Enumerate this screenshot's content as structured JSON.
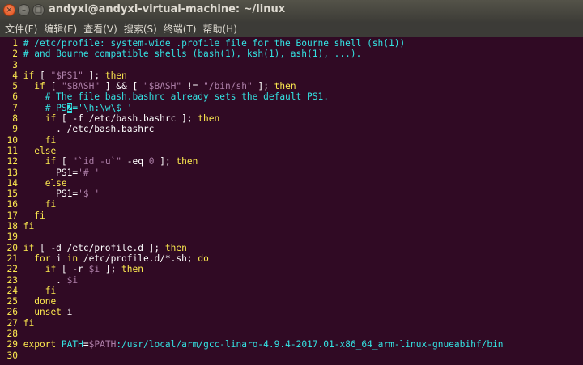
{
  "window": {
    "title": "andyxi@andyxi-virtual-machine: ~/linux",
    "close_glyph": "×",
    "min_glyph": "–",
    "max_glyph": "□"
  },
  "menu": [
    "文件(F)",
    "编辑(E)",
    "查看(V)",
    "搜索(S)",
    "终端(T)",
    "帮助(H)"
  ],
  "colors": {
    "background": "#300a24",
    "line_number": "#fce94f",
    "comment": "#34e2e2",
    "keyword": "#fce94f",
    "string": "#ad7fa8",
    "text": "#ffffff"
  },
  "lines": [
    {
      "n": "1",
      "segs": [
        [
          "c",
          "# /etc/profile: system-wide .profile file for the Bourne shell (sh(1))"
        ]
      ]
    },
    {
      "n": "2",
      "segs": [
        [
          "c",
          "# and Bourne compatible shells (bash(1), ksh(1), ash(1), ...)."
        ]
      ]
    },
    {
      "n": "3",
      "segs": []
    },
    {
      "n": "4",
      "segs": [
        [
          "k",
          "if"
        ],
        [
          "w",
          " [ "
        ],
        [
          "s",
          "\"$PS1\""
        ],
        [
          "w",
          " ]; "
        ],
        [
          "k",
          "then"
        ]
      ]
    },
    {
      "n": "5",
      "segs": [
        [
          "w",
          "  "
        ],
        [
          "k",
          "if"
        ],
        [
          "w",
          " [ "
        ],
        [
          "s",
          "\"$BASH\""
        ],
        [
          "w",
          " ] && [ "
        ],
        [
          "s",
          "\"$BASH\""
        ],
        [
          "w",
          " != "
        ],
        [
          "s",
          "\"/bin/sh\""
        ],
        [
          "w",
          " ]; "
        ],
        [
          "k",
          "then"
        ]
      ]
    },
    {
      "n": "6",
      "segs": [
        [
          "c",
          "    # The file bash.bashrc already sets the default PS1."
        ]
      ]
    },
    {
      "n": "7",
      "segs": [
        [
          "c",
          "    # PS"
        ],
        [
          "cur",
          "2"
        ],
        [
          "c",
          "='\\h:\\w\\$ '"
        ]
      ]
    },
    {
      "n": "8",
      "segs": [
        [
          "w",
          "    "
        ],
        [
          "k",
          "if"
        ],
        [
          "w",
          " [ -f /etc/bash.bashrc ]; "
        ],
        [
          "k",
          "then"
        ]
      ]
    },
    {
      "n": "9",
      "segs": [
        [
          "w",
          "      . /etc/bash.bashrc"
        ]
      ]
    },
    {
      "n": "10",
      "segs": [
        [
          "w",
          "    "
        ],
        [
          "k",
          "fi"
        ]
      ]
    },
    {
      "n": "11",
      "segs": [
        [
          "w",
          "  "
        ],
        [
          "k",
          "else"
        ]
      ]
    },
    {
      "n": "12",
      "segs": [
        [
          "w",
          "    "
        ],
        [
          "k",
          "if"
        ],
        [
          "w",
          " [ "
        ],
        [
          "s",
          "\"`id -u`\""
        ],
        [
          "w",
          " -eq "
        ],
        [
          "s",
          "0"
        ],
        [
          "w",
          " ]; "
        ],
        [
          "k",
          "then"
        ]
      ]
    },
    {
      "n": "13",
      "segs": [
        [
          "w",
          "      PS1="
        ],
        [
          "s",
          "'# '"
        ]
      ]
    },
    {
      "n": "14",
      "segs": [
        [
          "w",
          "    "
        ],
        [
          "k",
          "else"
        ]
      ]
    },
    {
      "n": "15",
      "segs": [
        [
          "w",
          "      PS1="
        ],
        [
          "s",
          "'$ '"
        ]
      ]
    },
    {
      "n": "16",
      "segs": [
        [
          "w",
          "    "
        ],
        [
          "k",
          "fi"
        ]
      ]
    },
    {
      "n": "17",
      "segs": [
        [
          "w",
          "  "
        ],
        [
          "k",
          "fi"
        ]
      ]
    },
    {
      "n": "18",
      "segs": [
        [
          "k",
          "fi"
        ]
      ]
    },
    {
      "n": "19",
      "segs": []
    },
    {
      "n": "20",
      "segs": [
        [
          "k",
          "if"
        ],
        [
          "w",
          " [ -d /etc/profile.d ]; "
        ],
        [
          "k",
          "then"
        ]
      ]
    },
    {
      "n": "21",
      "segs": [
        [
          "w",
          "  "
        ],
        [
          "k",
          "for"
        ],
        [
          "w",
          " i "
        ],
        [
          "k",
          "in"
        ],
        [
          "w",
          " /etc/profile.d/*.sh; "
        ],
        [
          "k",
          "do"
        ]
      ]
    },
    {
      "n": "22",
      "segs": [
        [
          "w",
          "    "
        ],
        [
          "k",
          "if"
        ],
        [
          "w",
          " [ -r "
        ],
        [
          "s",
          "$i"
        ],
        [
          "w",
          " ]; "
        ],
        [
          "k",
          "then"
        ]
      ]
    },
    {
      "n": "23",
      "segs": [
        [
          "w",
          "      . "
        ],
        [
          "s",
          "$i"
        ]
      ]
    },
    {
      "n": "24",
      "segs": [
        [
          "w",
          "    "
        ],
        [
          "k",
          "fi"
        ]
      ]
    },
    {
      "n": "25",
      "segs": [
        [
          "w",
          "  "
        ],
        [
          "k",
          "done"
        ]
      ]
    },
    {
      "n": "26",
      "segs": [
        [
          "w",
          "  "
        ],
        [
          "k",
          "unset"
        ],
        [
          "w",
          " i"
        ]
      ]
    },
    {
      "n": "27",
      "segs": [
        [
          "k",
          "fi"
        ]
      ]
    },
    {
      "n": "28",
      "segs": []
    },
    {
      "n": "29",
      "segs": [
        [
          "k",
          "export"
        ],
        [
          "w",
          " "
        ],
        [
          "c",
          "PATH"
        ],
        [
          "w",
          "="
        ],
        [
          "s",
          "$PATH"
        ],
        [
          "c",
          ":/usr/local/arm/gcc-linaro-4.9.4-2017.01-x86_64_arm-linux-gnueabihf/bin"
        ]
      ]
    },
    {
      "n": "30",
      "segs": []
    }
  ]
}
